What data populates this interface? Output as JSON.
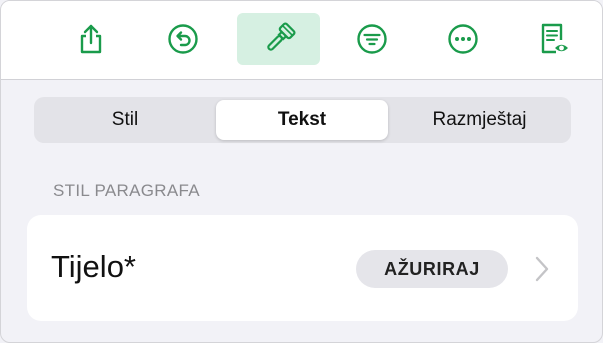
{
  "colors": {
    "accent": "#1a9b4b",
    "active_bg": "#d6f0e2"
  },
  "toolbar": {
    "buttons": [
      {
        "icon": "share-icon",
        "active": false
      },
      {
        "icon": "undo-icon",
        "active": false
      },
      {
        "icon": "format-brush-icon",
        "active": true
      },
      {
        "icon": "filter-icon",
        "active": false
      },
      {
        "icon": "more-icon",
        "active": false
      },
      {
        "icon": "reader-view-icon",
        "active": false
      }
    ]
  },
  "tabs": {
    "items": [
      {
        "label": "Stil"
      },
      {
        "label": "Tekst"
      },
      {
        "label": "Razmještaj"
      }
    ],
    "selected": "Tekst"
  },
  "paragraph_style": {
    "header": "STIL PARAGRAFA",
    "name": "Tijelo*",
    "update_label": "AŽURIRAJ"
  }
}
